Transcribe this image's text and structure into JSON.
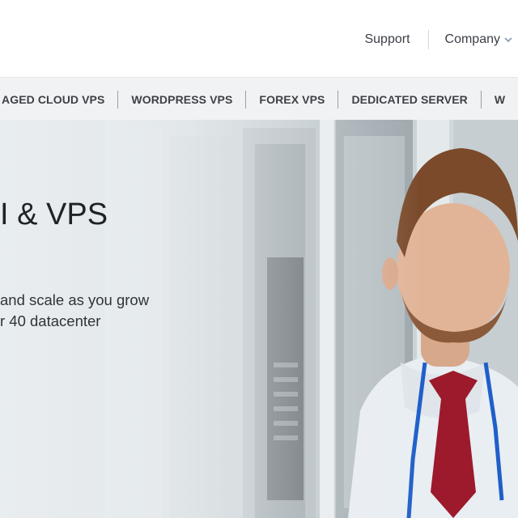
{
  "header": {
    "support_label": "Support",
    "company_label": "Company"
  },
  "menu": {
    "items": [
      "AGED CLOUD VPS",
      "WORDPRESS VPS",
      "FOREX VPS",
      "DEDICATED SERVER",
      "W"
    ]
  },
  "hero": {
    "title": "I & VPS",
    "subtitle_line1": "and scale as you grow",
    "subtitle_line2": "r 40 datacenter"
  },
  "colors": {
    "menu_bg": "#f1f2f3",
    "text_dark": "#3a3f45",
    "tie": "#9c1a2c",
    "lanyard": "#1f5fc9"
  }
}
